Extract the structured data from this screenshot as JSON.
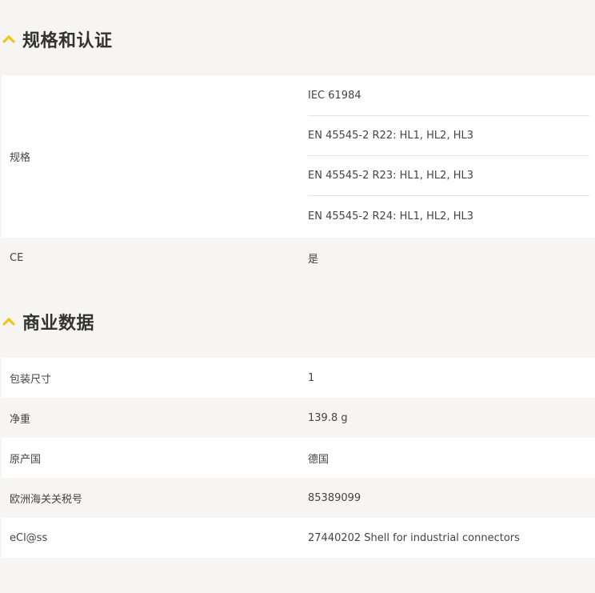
{
  "sections": [
    {
      "title": "规格和认证",
      "rows": [
        {
          "key": "规格",
          "values": [
            "IEC 61984",
            "EN 45545-2 R22: HL1, HL2, HL3",
            "EN 45545-2 R23: HL1, HL2, HL3",
            "EN 45545-2 R24: HL1, HL2, HL3"
          ]
        },
        {
          "key": "CE",
          "value": "是"
        }
      ]
    },
    {
      "title": "商业数据",
      "rows": [
        {
          "key": "包装尺寸",
          "value": "1"
        },
        {
          "key": "净重",
          "value": "139.8 g"
        },
        {
          "key": "原产国",
          "value": "德国"
        },
        {
          "key": "欧洲海关关税号",
          "value": "85389099"
        },
        {
          "key": "eCl@ss",
          "value": "27440202 Shell for industrial connectors"
        }
      ]
    }
  ],
  "colors": {
    "accent": "#f2c417",
    "background": "#f6f5f3",
    "row_white": "#ffffff"
  },
  "icons": {
    "section_toggle": "chevron-up-icon"
  }
}
